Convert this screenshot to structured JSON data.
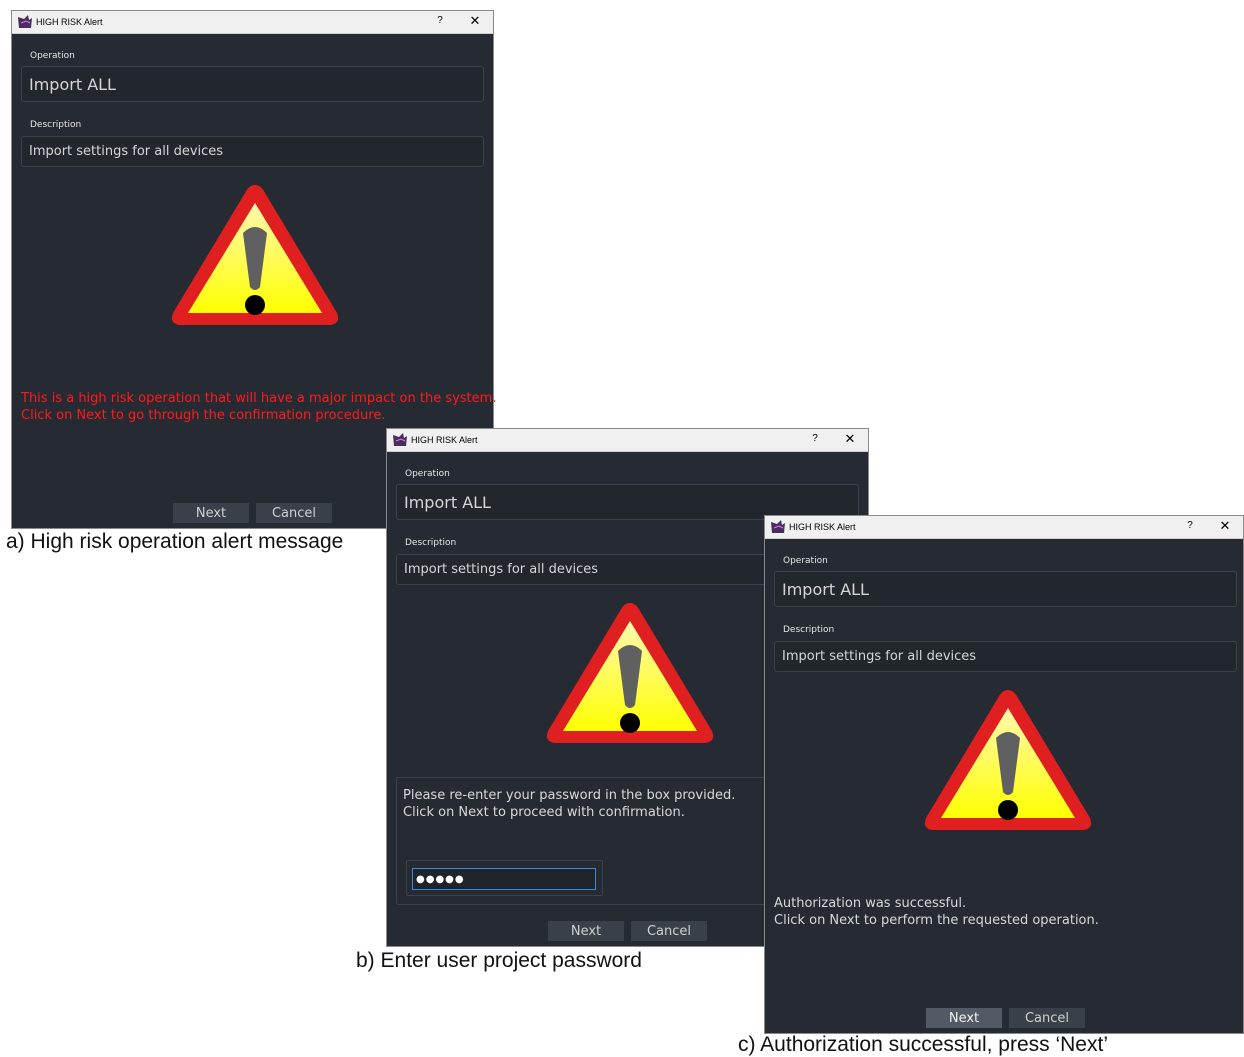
{
  "colors": {
    "dialog_bg": "#262b33",
    "field_bg": "#22262d",
    "risk_text": "#ff1a1a",
    "focus_border": "#3d86d8",
    "warning_yellow": "#ffff00",
    "warning_red": "#e02020"
  },
  "dialogs": [
    {
      "title": "HIGH RISK Alert",
      "help_glyph": "?",
      "close_glyph": "✕",
      "operation_label": "Operation",
      "operation_value": "Import ALL",
      "description_label": "Description",
      "description_value": "Import settings for all devices",
      "message": "This is a high risk operation that will have a major impact on the system.\nClick on Next to go through the confirmation procedure.",
      "next_label": "Next",
      "cancel_label": "Cancel",
      "caption": "a) High risk operation alert message"
    },
    {
      "title": "HIGH RISK Alert",
      "help_glyph": "?",
      "close_glyph": "✕",
      "operation_label": "Operation",
      "operation_value": "Import ALL",
      "description_label": "Description",
      "description_value": "Import settings for all devices",
      "message": "Please re-enter your password in the box provided.\nClick on Next to proceed with confirmation.",
      "password_masked": "●●●●●",
      "next_label": "Next",
      "cancel_label": "Cancel",
      "caption": "b) Enter user project password"
    },
    {
      "title": "HIGH RISK Alert",
      "help_glyph": "?",
      "close_glyph": "✕",
      "operation_label": "Operation",
      "operation_value": "Import ALL",
      "description_label": "Description",
      "description_value": "Import settings for all devices",
      "message": "Authorization was successful.\nClick on Next to perform the requested operation.",
      "next_label": "Next",
      "cancel_label": "Cancel",
      "caption": "c) Authorization successful, press ‘Next’"
    }
  ]
}
